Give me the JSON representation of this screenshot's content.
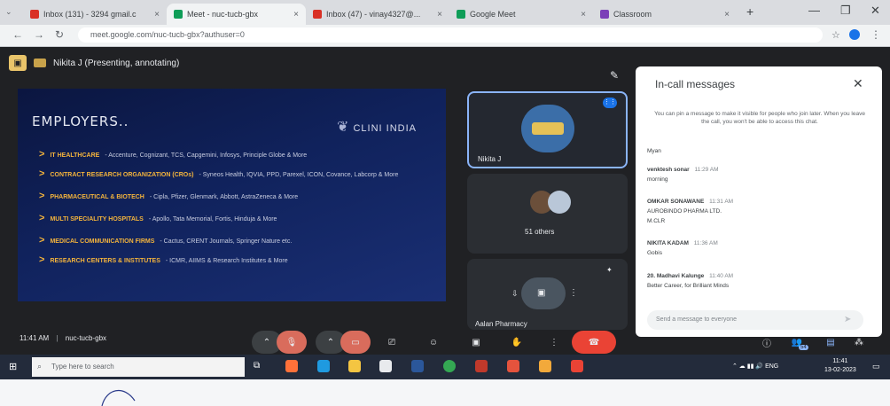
{
  "browser": {
    "tabs": [
      {
        "label": "Inbox (131) - 3294 gmail.c",
        "icon": "gmail-icon",
        "color": "#d93025",
        "active": false
      },
      {
        "label": "Meet - nuc-tucb-gbx",
        "icon": "meet-icon",
        "color": "#0f9d58",
        "active": true
      },
      {
        "label": "Inbox (47) - vinay4327@...",
        "icon": "gmail-icon",
        "color": "#d93025",
        "active": false
      },
      {
        "label": "Google Meet",
        "icon": "meet-icon",
        "color": "#0f9d58",
        "active": false
      },
      {
        "label": "Classroom",
        "icon": "classroom-icon",
        "color": "#7b3fb8",
        "active": false
      }
    ],
    "new_tab": "+",
    "url": "meet.google.com/nuc-tucb-gbx?authuser=0"
  },
  "meet": {
    "presenter": "Nikita J (Presenting, annotating)",
    "slide": {
      "title": "EMPLOYERS..",
      "logo": "CLINI INDIA",
      "bullets": [
        {
          "head": "IT HEALTHCARE",
          "text": "- Accenture, Cognizant, TCS, Capgemini, Infosys, Principle Globe & More"
        },
        {
          "head": "CONTRACT RESEARCH ORGANIZATION (CROs)",
          "text": "- Syneos Health, IQVIA, PPD, Parexel, ICON, Covance, Labcorp & More"
        },
        {
          "head": "PHARMACEUTICAL & BIOTECH",
          "text": "- Cipla, Pfizer, Glenmark, Abbott, AstraZeneca & More"
        },
        {
          "head": "MULTI SPECIALITY HOSPITALS",
          "text": "- Apollo, Tata Memorial, Fortis, Hinduja & More"
        },
        {
          "head": "MEDICAL COMMUNICATION FIRMS",
          "text": "- Cactus, CRENT Journals, Springer Nature etc."
        },
        {
          "head": "RESEARCH CENTERS & INSTITUTES",
          "text": "- ICMR, AIIMS & Research Institutes & More"
        }
      ]
    },
    "tiles": [
      {
        "name": "Nikita J"
      },
      {
        "name": "51 others"
      },
      {
        "name": "Aalan Pharmacy"
      }
    ],
    "meeting_time": "11:41 AM",
    "meeting_code": "nuc-tucb-gbx",
    "participant_count": "54"
  },
  "chat": {
    "title": "In-call messages",
    "info": "You can pin a message to make it visible for people who join later. When you leave the call, you won't be able to access this chat.",
    "messages": [
      {
        "sender": "Myan",
        "time": "",
        "text": ""
      },
      {
        "sender": "venktesh sonar",
        "time": "11:29 AM",
        "text": "morning"
      },
      {
        "sender": "OMKAR SONAWANE",
        "time": "11:31 AM",
        "text": "AUROBINDO PHARMA LTD."
      },
      {
        "sender": "",
        "time": "",
        "text": "M.CLR"
      },
      {
        "sender": "NIKITA KADAM",
        "time": "11:36 AM",
        "text": "Gobis"
      },
      {
        "sender": "20. Madhavi Kalunge",
        "time": "11:40 AM",
        "text": "Better Career, for Brilliant Minds"
      }
    ],
    "input_placeholder": "Send a message to everyone"
  },
  "taskbar": {
    "search_placeholder": "Type here to search",
    "time": "11:41",
    "date": "13-02-2023"
  }
}
